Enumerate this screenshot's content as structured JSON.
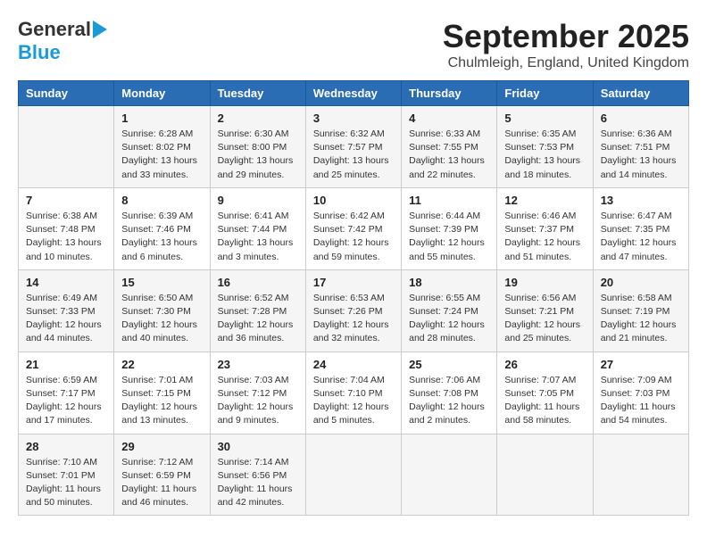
{
  "header": {
    "logo_general": "General",
    "logo_blue": "Blue",
    "month_title": "September 2025",
    "location": "Chulmleigh, England, United Kingdom"
  },
  "weekdays": [
    "Sunday",
    "Monday",
    "Tuesday",
    "Wednesday",
    "Thursday",
    "Friday",
    "Saturday"
  ],
  "weeks": [
    [
      {
        "day": "",
        "info": ""
      },
      {
        "day": "1",
        "info": "Sunrise: 6:28 AM\nSunset: 8:02 PM\nDaylight: 13 hours\nand 33 minutes."
      },
      {
        "day": "2",
        "info": "Sunrise: 6:30 AM\nSunset: 8:00 PM\nDaylight: 13 hours\nand 29 minutes."
      },
      {
        "day": "3",
        "info": "Sunrise: 6:32 AM\nSunset: 7:57 PM\nDaylight: 13 hours\nand 25 minutes."
      },
      {
        "day": "4",
        "info": "Sunrise: 6:33 AM\nSunset: 7:55 PM\nDaylight: 13 hours\nand 22 minutes."
      },
      {
        "day": "5",
        "info": "Sunrise: 6:35 AM\nSunset: 7:53 PM\nDaylight: 13 hours\nand 18 minutes."
      },
      {
        "day": "6",
        "info": "Sunrise: 6:36 AM\nSunset: 7:51 PM\nDaylight: 13 hours\nand 14 minutes."
      }
    ],
    [
      {
        "day": "7",
        "info": "Sunrise: 6:38 AM\nSunset: 7:48 PM\nDaylight: 13 hours\nand 10 minutes."
      },
      {
        "day": "8",
        "info": "Sunrise: 6:39 AM\nSunset: 7:46 PM\nDaylight: 13 hours\nand 6 minutes."
      },
      {
        "day": "9",
        "info": "Sunrise: 6:41 AM\nSunset: 7:44 PM\nDaylight: 13 hours\nand 3 minutes."
      },
      {
        "day": "10",
        "info": "Sunrise: 6:42 AM\nSunset: 7:42 PM\nDaylight: 12 hours\nand 59 minutes."
      },
      {
        "day": "11",
        "info": "Sunrise: 6:44 AM\nSunset: 7:39 PM\nDaylight: 12 hours\nand 55 minutes."
      },
      {
        "day": "12",
        "info": "Sunrise: 6:46 AM\nSunset: 7:37 PM\nDaylight: 12 hours\nand 51 minutes."
      },
      {
        "day": "13",
        "info": "Sunrise: 6:47 AM\nSunset: 7:35 PM\nDaylight: 12 hours\nand 47 minutes."
      }
    ],
    [
      {
        "day": "14",
        "info": "Sunrise: 6:49 AM\nSunset: 7:33 PM\nDaylight: 12 hours\nand 44 minutes."
      },
      {
        "day": "15",
        "info": "Sunrise: 6:50 AM\nSunset: 7:30 PM\nDaylight: 12 hours\nand 40 minutes."
      },
      {
        "day": "16",
        "info": "Sunrise: 6:52 AM\nSunset: 7:28 PM\nDaylight: 12 hours\nand 36 minutes."
      },
      {
        "day": "17",
        "info": "Sunrise: 6:53 AM\nSunset: 7:26 PM\nDaylight: 12 hours\nand 32 minutes."
      },
      {
        "day": "18",
        "info": "Sunrise: 6:55 AM\nSunset: 7:24 PM\nDaylight: 12 hours\nand 28 minutes."
      },
      {
        "day": "19",
        "info": "Sunrise: 6:56 AM\nSunset: 7:21 PM\nDaylight: 12 hours\nand 25 minutes."
      },
      {
        "day": "20",
        "info": "Sunrise: 6:58 AM\nSunset: 7:19 PM\nDaylight: 12 hours\nand 21 minutes."
      }
    ],
    [
      {
        "day": "21",
        "info": "Sunrise: 6:59 AM\nSunset: 7:17 PM\nDaylight: 12 hours\nand 17 minutes."
      },
      {
        "day": "22",
        "info": "Sunrise: 7:01 AM\nSunset: 7:15 PM\nDaylight: 12 hours\nand 13 minutes."
      },
      {
        "day": "23",
        "info": "Sunrise: 7:03 AM\nSunset: 7:12 PM\nDaylight: 12 hours\nand 9 minutes."
      },
      {
        "day": "24",
        "info": "Sunrise: 7:04 AM\nSunset: 7:10 PM\nDaylight: 12 hours\nand 5 minutes."
      },
      {
        "day": "25",
        "info": "Sunrise: 7:06 AM\nSunset: 7:08 PM\nDaylight: 12 hours\nand 2 minutes."
      },
      {
        "day": "26",
        "info": "Sunrise: 7:07 AM\nSunset: 7:05 PM\nDaylight: 11 hours\nand 58 minutes."
      },
      {
        "day": "27",
        "info": "Sunrise: 7:09 AM\nSunset: 7:03 PM\nDaylight: 11 hours\nand 54 minutes."
      }
    ],
    [
      {
        "day": "28",
        "info": "Sunrise: 7:10 AM\nSunset: 7:01 PM\nDaylight: 11 hours\nand 50 minutes."
      },
      {
        "day": "29",
        "info": "Sunrise: 7:12 AM\nSunset: 6:59 PM\nDaylight: 11 hours\nand 46 minutes."
      },
      {
        "day": "30",
        "info": "Sunrise: 7:14 AM\nSunset: 6:56 PM\nDaylight: 11 hours\nand 42 minutes."
      },
      {
        "day": "",
        "info": ""
      },
      {
        "day": "",
        "info": ""
      },
      {
        "day": "",
        "info": ""
      },
      {
        "day": "",
        "info": ""
      }
    ]
  ]
}
